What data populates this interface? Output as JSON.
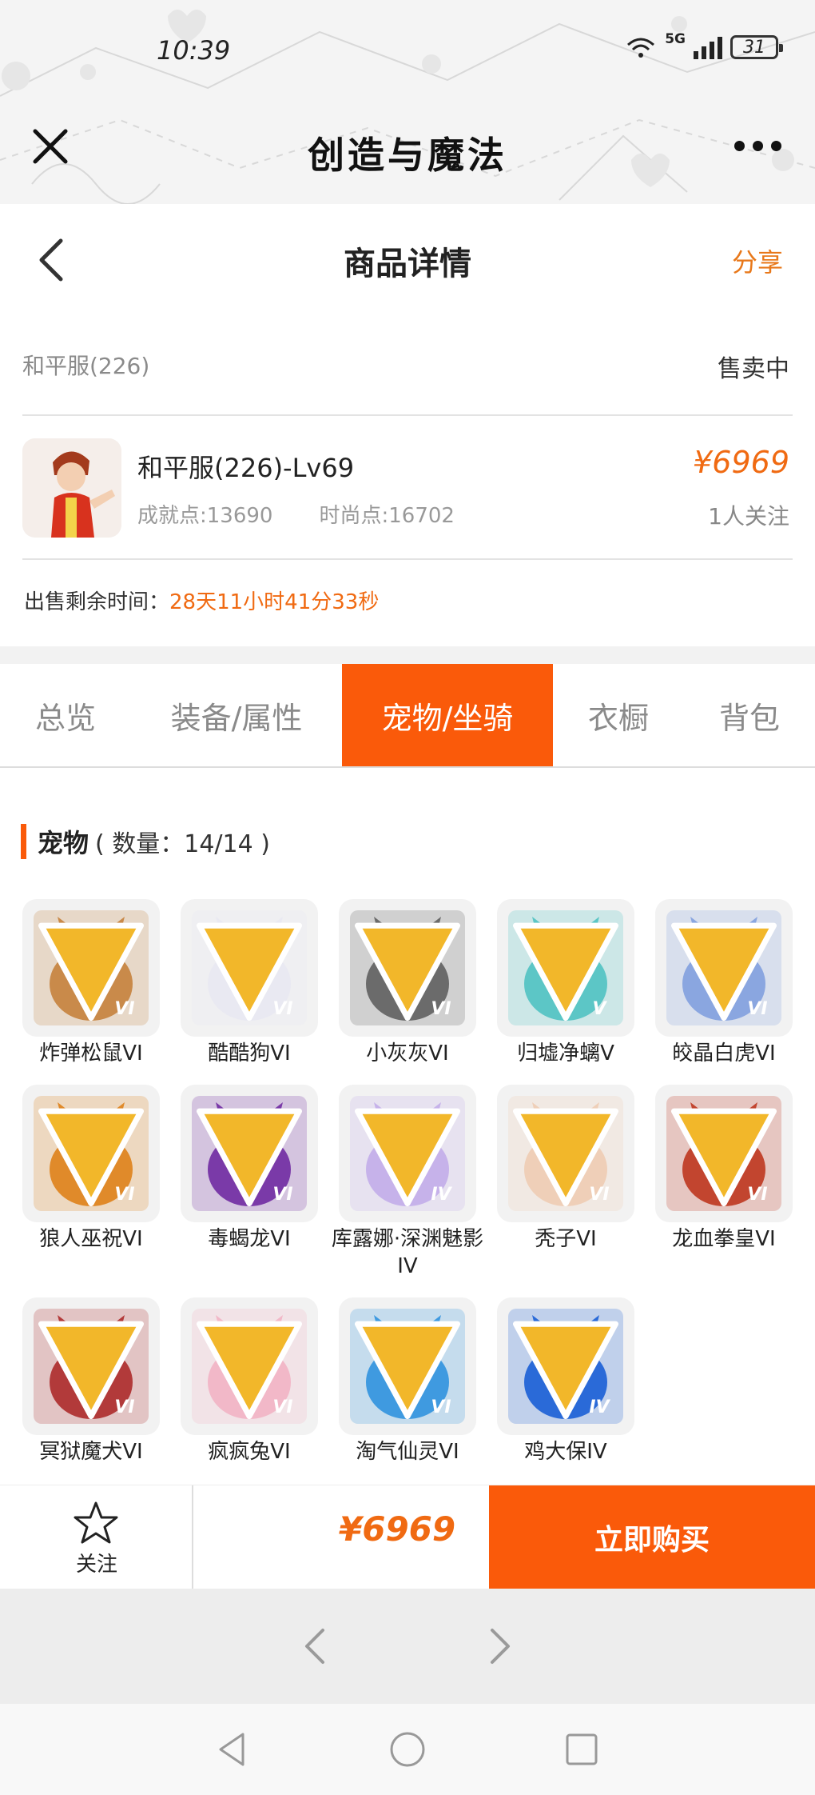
{
  "status_bar": {
    "time": "10:39",
    "network": "5G",
    "battery": "31"
  },
  "app_bar": {
    "title": "创造与魔法"
  },
  "nav": {
    "title": "商品详情",
    "share": "分享"
  },
  "listing": {
    "server": "和平服(226)",
    "sale_status": "售卖中",
    "name": "和平服(226)-Lv69",
    "achievement": "成就点:13690",
    "fashion": "时尚点:16702",
    "price": "¥6969",
    "followers": "1人关注",
    "remaining_label": "出售剩余时间：",
    "remaining_value": "28天11小时41分33秒"
  },
  "tabs": [
    {
      "label": "总览",
      "active": false
    },
    {
      "label": "装备/属性",
      "active": false
    },
    {
      "label": "宠物/坐骑",
      "active": true
    },
    {
      "label": "衣橱",
      "active": false
    },
    {
      "label": "背包",
      "active": false
    }
  ],
  "section": {
    "title": "宠物",
    "count": "( 数量：14/14 )"
  },
  "pets": [
    {
      "name": "炸弹松鼠VI",
      "level": "VI",
      "color": "#c98a4a"
    },
    {
      "name": "酷酷狗VI",
      "level": "VI",
      "color": "#e9e9f2"
    },
    {
      "name": "小灰灰VI",
      "level": "VI",
      "color": "#6b6b6b"
    },
    {
      "name": "归墟净螭V",
      "level": "V",
      "color": "#5cc6c6"
    },
    {
      "name": "皎晶白虎VI",
      "level": "VI",
      "color": "#8aa6e0"
    },
    {
      "name": "狼人巫祝VI",
      "level": "VI",
      "color": "#e08a2a"
    },
    {
      "name": "毒蝎龙VI",
      "level": "VI",
      "color": "#7a3aa8"
    },
    {
      "name": "库露娜·深渊魅影IV",
      "level": "IV",
      "color": "#c6b2ea"
    },
    {
      "name": "秃子VI",
      "level": "VI",
      "color": "#efcfb8"
    },
    {
      "name": "龙血拳皇VI",
      "level": "VI",
      "color": "#c2452f"
    },
    {
      "name": "冥狱魔犬VI",
      "level": "VI",
      "color": "#b23a3a"
    },
    {
      "name": "疯疯兔VI",
      "level": "VI",
      "color": "#f2b8c8"
    },
    {
      "name": "淘气仙灵VI",
      "level": "VI",
      "color": "#3f9ae0"
    },
    {
      "name": "鸡大保IV",
      "level": "IV",
      "color": "#2a6ad8"
    }
  ],
  "bottom_bar": {
    "follow": "关注",
    "price": "¥6969",
    "buy": "立即购买"
  }
}
